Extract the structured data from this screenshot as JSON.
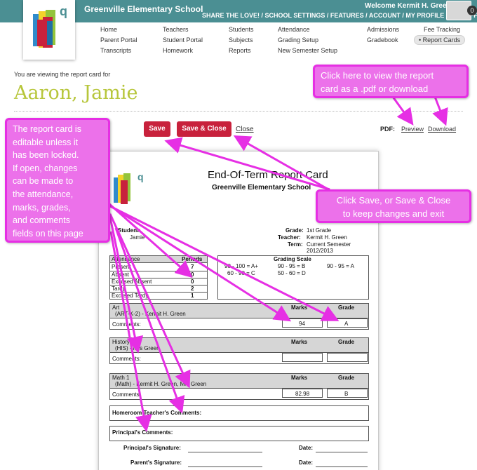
{
  "header": {
    "school_name": "Greenville Elementary School",
    "welcome": "Welcome Kermit H. Green",
    "top_links": "SHARE THE LOVE! / SCHOOL SETTINGS / FEATURES / ACCOUNT / MY PROFILE / LOG OFF",
    "notification_count": "0",
    "accent_color": "#4b8f93"
  },
  "nav": {
    "col1": [
      "Home",
      "Parent Portal",
      "Transcripts"
    ],
    "col2": [
      "Teachers",
      "Student Portal",
      "Homework"
    ],
    "col3": [
      "Students",
      "Subjects",
      "Reports"
    ],
    "col4": [
      "Attendance",
      "Grading Setup",
      "New Semester Setup"
    ],
    "col5": [
      "Admissions",
      "Gradebook"
    ],
    "col6": [
      "Fee Tracking",
      "Report Cards"
    ]
  },
  "page": {
    "viewing_text": "You are viewing the report card for",
    "student_name": "Aaron, Jamie",
    "save_label": "Save",
    "save_close_label": "Save & Close",
    "close_label": "Close",
    "pdf_label": "PDF:",
    "preview_label": "Preview",
    "download_label": "Download"
  },
  "report_card": {
    "title": "End-Of-Term Report Card",
    "school": "Greenville Elementary School",
    "student_label": "Student:",
    "student_value": "Jamie",
    "grade_label": "Grade:",
    "grade_value": "1st Grade",
    "teacher_label": "Teacher:",
    "teacher_value": "Kermit H. Green",
    "term_label": "Term:",
    "term_value": "Current Semester",
    "term_year": "2012/2013",
    "attendance_header": "Attendance",
    "periods_header": "Periods",
    "attendance_rows": [
      {
        "label": "Present",
        "value": "7"
      },
      {
        "label": "Absent",
        "value": "0"
      },
      {
        "label": "Excused Absent",
        "value": "0"
      },
      {
        "label": "Tardy",
        "value": "2"
      },
      {
        "label": "Excused Tardy",
        "value": "1"
      }
    ],
    "grading_scale_title": "Grading Scale",
    "grading_scale": [
      "90 - 100 = A+",
      "90 - 95 = B",
      "90 - 95 = A",
      "60 - 90 = C",
      "50 - 60 = D"
    ],
    "subjects": [
      {
        "name": "Art",
        "code": "(ART-K-2) - Kermit H. Green",
        "marks": "94",
        "grade": "A"
      },
      {
        "name": "History",
        "code": "(HIS) - Mrs Green",
        "marks": "",
        "grade": ""
      },
      {
        "name": "Math 1",
        "code": "(Math) - Kermit H. Green, Mrs Green",
        "marks": "82.98",
        "grade": "B"
      }
    ],
    "marks_header": "Marks",
    "grade_header": "Grade",
    "comments_label": "Comments:",
    "homeroom_comments": "Homeroom Teacher's Comments:",
    "principal_comments": "Principal's Comments:",
    "principal_signature": "Principal's Signature:",
    "parent_signature": "Parent's Signature:",
    "date_label": "Date:"
  },
  "callouts": {
    "left": [
      "The report card is",
      "editable unless it",
      "has been locked.",
      "If open, changes",
      "can be made to",
      "the attendance,",
      "marks, grades,",
      "and comments",
      "fields on this page"
    ],
    "top_right": [
      "Click here to view the report",
      "card as a .pdf or download"
    ],
    "right": [
      "Click Save, or Save & Close",
      "to keep changes and exit"
    ],
    "color": "#ec71ea"
  }
}
